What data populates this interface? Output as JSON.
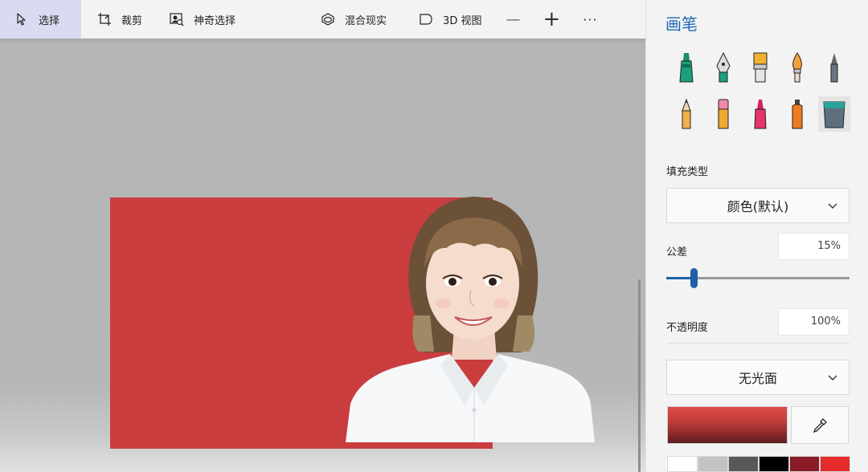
{
  "toolbar": {
    "select_label": "选择",
    "crop_label": "裁剪",
    "magic_select_label": "神奇选择",
    "mixed_reality_label": "混合现实",
    "view3d_label": "3D 视图",
    "zoom_out_glyph": "—",
    "zoom_in_glyph": "+",
    "more_glyph": "···"
  },
  "panel": {
    "title": "画笔",
    "brushes": [
      "marker",
      "calligraphy-pen",
      "oil-brush",
      "watercolor",
      "pencil",
      "crayon",
      "pixel-pen",
      "marker-pink",
      "spray-can",
      "fill-bucket"
    ],
    "fill_type_label": "填充类型",
    "fill_type_value": "颜色(默认)",
    "tolerance_label": "公差",
    "tolerance_value": "15%",
    "tolerance_percent": 15,
    "opacity_label": "不透明度",
    "opacity_value": "100%",
    "finish_value": "无光面",
    "swatches": [
      "#ffffff",
      "#c3c3c3",
      "#585858",
      "#000000",
      "#8b1b26",
      "#e52b2b"
    ]
  },
  "canvas": {
    "background_color": "#c93d3e"
  },
  "colors": {
    "accent": "#1b67b6",
    "active_tool_bg": "#d9dcf0",
    "canvas_red": "#c93d3e"
  }
}
